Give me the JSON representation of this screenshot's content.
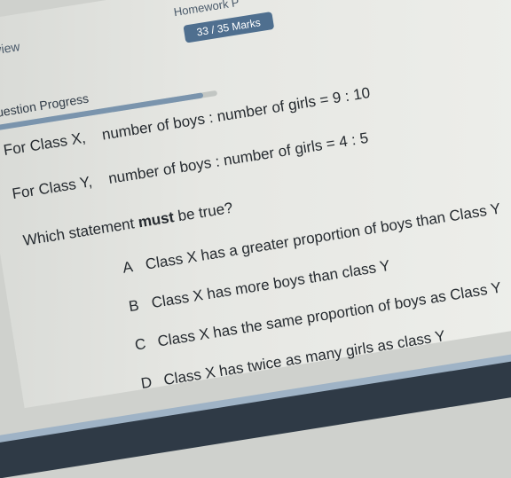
{
  "tabs": {
    "overview": "erview",
    "homework": "Homework P"
  },
  "marks_badge": "33 / 35 Marks",
  "progress": {
    "label": "Question Progress",
    "fraction": 0.94
  },
  "ratios": {
    "x_class": "For Class X,",
    "x_text": "number of boys : number of girls = 9 : 10",
    "y_class": "For Class Y,",
    "y_text": "number of boys : number of girls = 4 : 5"
  },
  "question": {
    "before": "Which statement ",
    "emphasis": "must",
    "after": " be true?"
  },
  "options": [
    {
      "letter": "A",
      "text": "Class X has a greater proportion of boys than Class Y"
    },
    {
      "letter": "B",
      "text": "Class X has more boys than class Y"
    },
    {
      "letter": "C",
      "text": "Class X has the same proportion of boys as Class Y"
    },
    {
      "letter": "D",
      "text": "Class X has twice as many girls as class Y"
    }
  ]
}
